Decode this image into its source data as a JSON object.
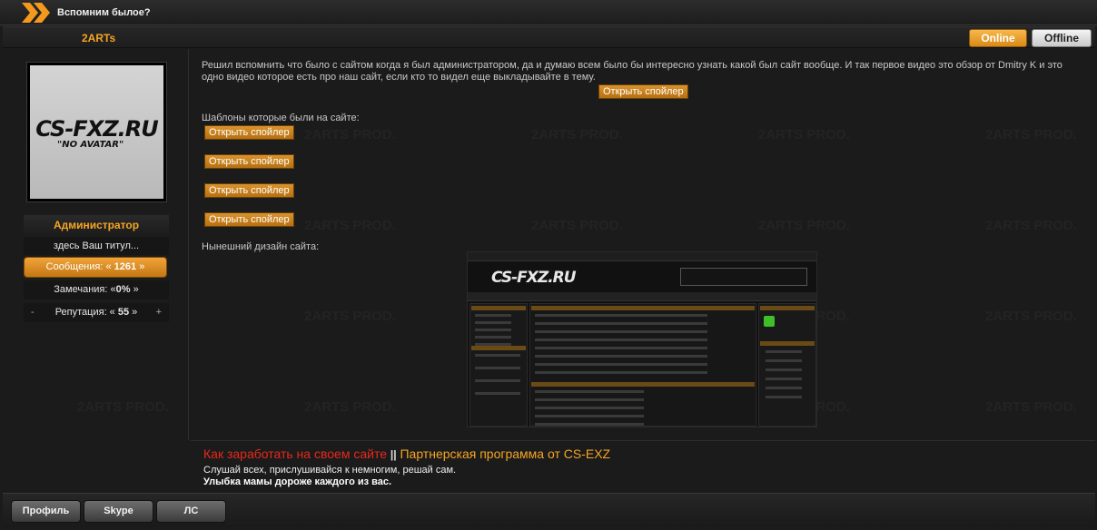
{
  "topic": {
    "title": "Вспомним былое?"
  },
  "author": {
    "name": "2ARTs",
    "status_online": "Online",
    "status_offline": "Offline"
  },
  "profile": {
    "avatar_line1": "CS-FXZ.RU",
    "avatar_line2": "\"NO AVATAR\"",
    "role": "Администратор",
    "user_title": "здесь Ваш титул...",
    "posts_label": "Сообщения: «",
    "posts_count": "1261",
    "posts_suffix": "»",
    "warnings_label": "Замечания: «",
    "warnings_value": "0%",
    "warnings_suffix": "»",
    "reputation_minus": "-",
    "reputation_label": "Репутация: «",
    "reputation_value": "55",
    "reputation_suffix": "»",
    "reputation_plus": "+"
  },
  "post": {
    "intro_text": "Решил вспомнить что было с сайтом когда я был администратором, да и думаю всем было бы интересно узнать какой был сайт вообще. И так первое видео это обзор от Dmitry K и это одно видео которое есть про наш сайт, если кто то видел еще выкладывайте в тему.",
    "spoiler_label": "Открыть спойлер",
    "templates_heading": "Шаблоны которые были на сайте:",
    "current_design_heading": "Нынешний дизайн сайта:",
    "screenshot_logo": "CS-FXZ.RU"
  },
  "signature": {
    "link1": "Как заработать на своем сайте",
    "divider": "||",
    "link2": "Партнерская программа от CS-EXZ",
    "line2": "Слушай всех, прислушивайся к немногим, решай сам.",
    "line3": "Улыбка мамы дороже каждого из вас."
  },
  "footer_buttons": {
    "profile": "Профиль",
    "skype": "Skype",
    "pm": "ЛС"
  },
  "watermark": "2ARTS PROD.",
  "colors": {
    "accent": "#f5a623",
    "background": "#1b1b1b",
    "signature_red": "#e8281c"
  }
}
